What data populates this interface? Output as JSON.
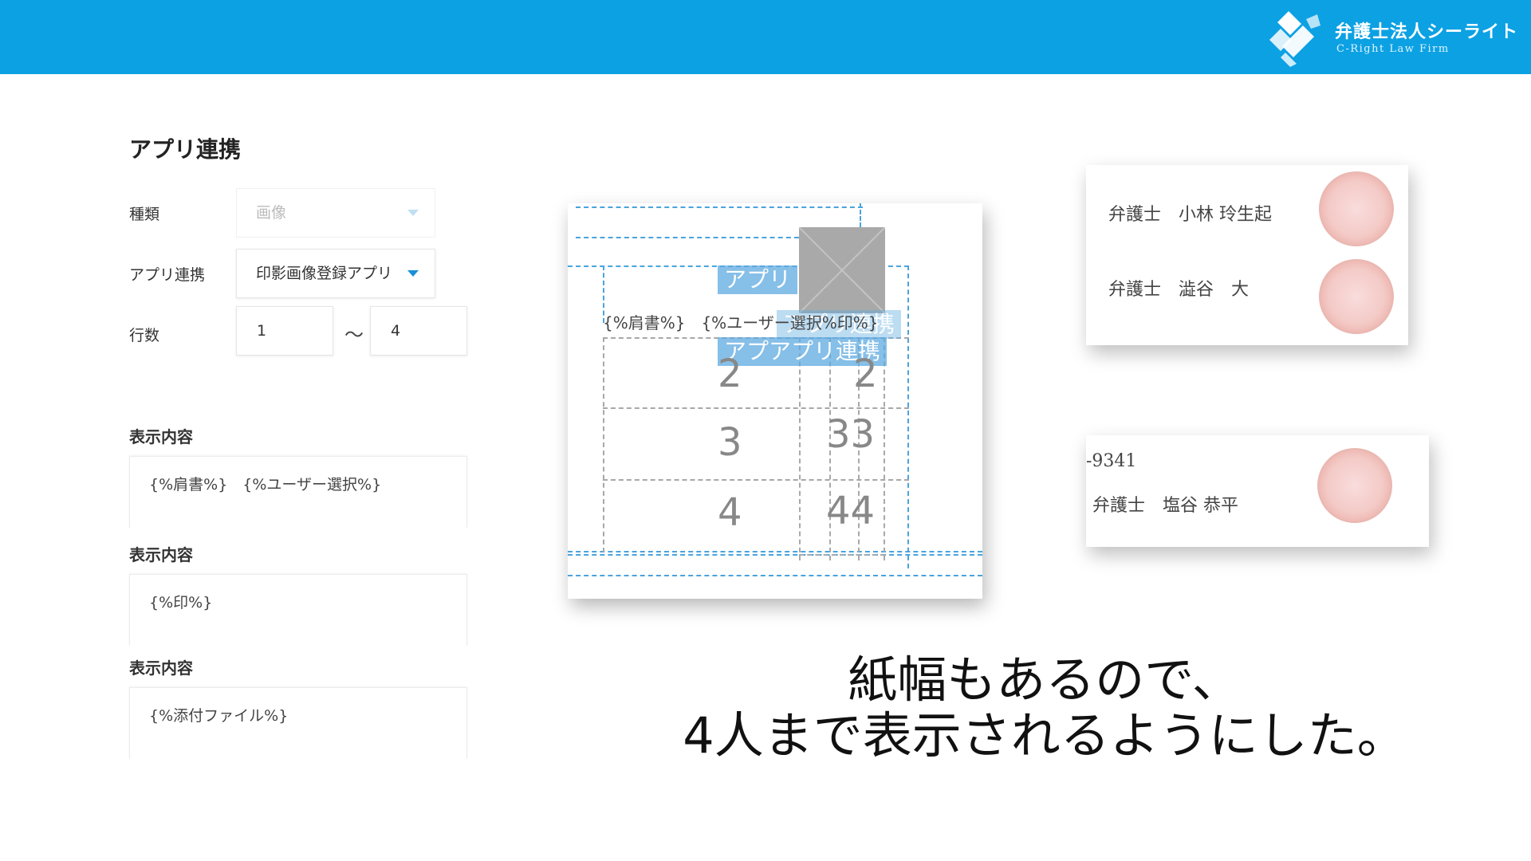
{
  "header": {
    "brand_title": "弁護士法人シーライト",
    "brand_subtitle": "C-Right Law Firm",
    "bg_color": "#0ca1e3"
  },
  "form": {
    "section_title": "アプリ連携",
    "type_label": "種類",
    "type_value": "画像",
    "app_label": "アプリ連携",
    "app_value": "印影画像登録アプリ",
    "rows_label": "行数",
    "rows_from": "1",
    "rows_tilde": "〜",
    "rows_to": "4",
    "display_blocks": [
      {
        "label": "表示内容",
        "value": "{%肩書%}　{%ユーザー選択%}"
      },
      {
        "label": "表示内容",
        "value": "{%印%}"
      },
      {
        "label": "表示内容",
        "value": "{%添付ファイル%}"
      }
    ]
  },
  "preview": {
    "field_text": "{%肩書%}　{%ユーザー選択%印%}",
    "label_app1": "アプリ",
    "label_app2": "アプリ連携",
    "label_app3": "アプアプリ連携",
    "num_2a": "2",
    "num_2b": "2",
    "num_3a": "3",
    "num_3b": "33",
    "num_4a": "4",
    "num_4b": "44"
  },
  "cards": [
    {
      "lines": [
        "弁護士　小林 玲生起",
        "弁護士　澁谷　大"
      ]
    },
    {
      "lines": [
        "-9341",
        "弁護士　塩谷 恭平"
      ]
    }
  ],
  "subtitle": {
    "line1": "紙幅もあるので、",
    "line2": "4人まで表示されるようにした。"
  }
}
